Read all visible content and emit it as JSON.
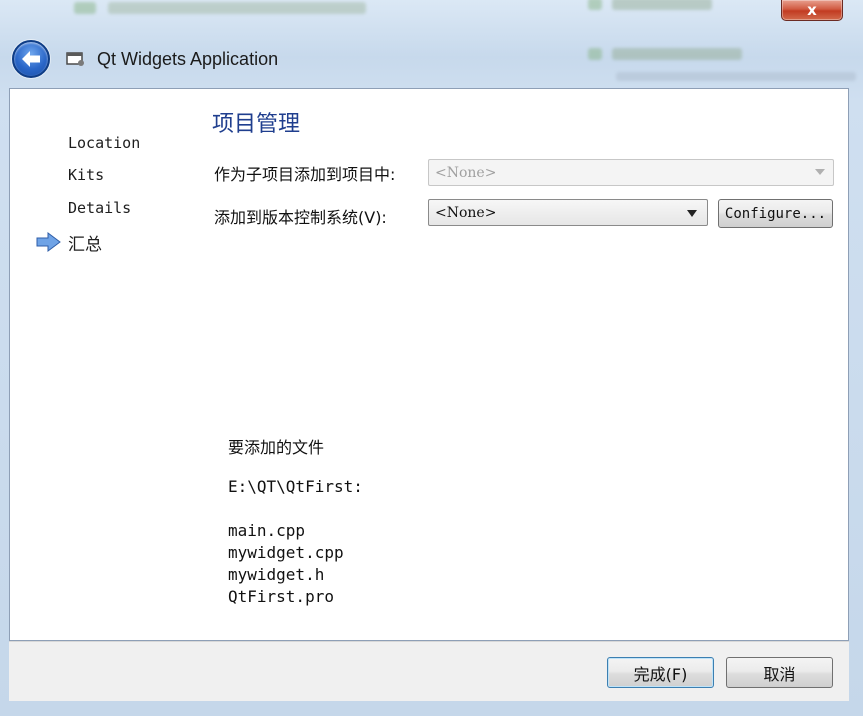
{
  "window": {
    "title": "Qt Widgets Application",
    "close_label": "x"
  },
  "sidebar": {
    "steps": [
      {
        "label": "Location"
      },
      {
        "label": "Kits"
      },
      {
        "label": "Details"
      },
      {
        "label": "汇总",
        "current": true
      }
    ]
  },
  "main": {
    "heading": "项目管理",
    "subproject": {
      "label": "作为子项目添加到项目中:",
      "value": "<None>",
      "enabled": false
    },
    "vcs": {
      "label": "添加到版本控制系统(V):",
      "value": "<None>",
      "configure_label": "Configure..."
    },
    "files": {
      "title": "要添加的文件",
      "directory": "E:\\QT\\QtFirst:",
      "list": [
        "main.cpp",
        "mywidget.cpp",
        "mywidget.h",
        "QtFirst.pro"
      ]
    }
  },
  "footer": {
    "finish_label": "完成(F)",
    "cancel_label": "取消"
  },
  "colors": {
    "heading": "#1f3e8e",
    "close": "#c23b22",
    "back": "#2a66c8"
  }
}
